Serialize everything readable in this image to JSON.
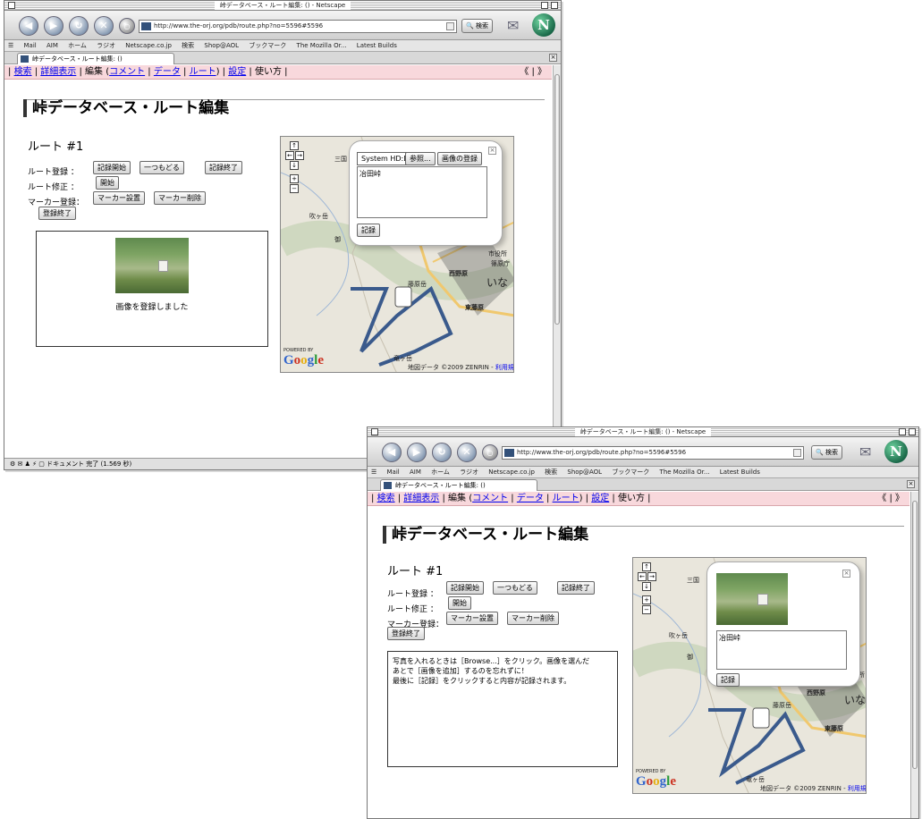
{
  "window": {
    "title": "峠データベース・ルート編集: () - Netscape",
    "url": "http://www.the-orj.org/pdb/route.php?no=5596#5596",
    "search_label": "検索",
    "tab_title_front": "峠データベース・ルート編集: ()",
    "tab_title_back": "峠データベース・ルート編集: ()",
    "personal_toolbar": [
      "Mail",
      "AIM",
      "ホーム",
      "ラジオ",
      "Netscape.co.jp",
      "検索",
      "Shop@AOL",
      "ブックマーク",
      "The Mozilla Or...",
      "Latest Builds"
    ],
    "status_text": "ドキュメント 完了 (1.569 秒)"
  },
  "nav": {
    "items": [
      {
        "label": "検索",
        "link": true
      },
      {
        "label": "詳細表示",
        "link": true
      },
      {
        "label": "編集",
        "link": false
      },
      {
        "label": "コメント",
        "link": true
      },
      {
        "label": "データ",
        "link": true
      },
      {
        "label": "ルート",
        "link": true
      },
      {
        "label": "設定",
        "link": true
      },
      {
        "label": "使い方",
        "link": false
      }
    ],
    "pager": "《 | 》"
  },
  "page": {
    "title": "峠データベース・ルート編集",
    "route_label": "ルート #1"
  },
  "form": {
    "route_register_label": "ルート登録 ：",
    "route_modify_label": "ルート修正 ：",
    "marker_register_label": "マーカー登録：",
    "btn_record_start": "記録開始",
    "btn_undo": "一つもどる",
    "btn_record_end": "記録終了",
    "btn_start": "開始",
    "btn_marker_set": "マーカー設置",
    "btn_marker_delete": "マーカー削除",
    "btn_register_end": "登録終了"
  },
  "status_box": {
    "message": "画像を登録しました"
  },
  "instructions": {
    "text": "写真を入れるときは［Browse...］をクリック。画像を選んだ\nあとで［画像を追加］するのを忘れずに！\n最後に［記録］をクリックすると内容が記録されます。"
  },
  "map": {
    "labels": [
      "三国",
      "吹ヶ岳",
      "市役所",
      "篠原庁",
      "西野原",
      "いな",
      "東藤原",
      "藤原岳",
      "竜ヶ岳",
      "御"
    ],
    "copyright": "地図データ ©2009 ZENRIN -",
    "terms_link": "利用規約",
    "powered_by": "POWERED BY",
    "google": [
      "G",
      "o",
      "o",
      "g",
      "l",
      "e"
    ]
  },
  "popup_front": {
    "file_value": "System HD:De",
    "browse_label": "参照...",
    "add_image_label": "画像の登録",
    "textarea_value": "冶田峠",
    "record_label": "記録"
  },
  "popup_back": {
    "textarea_value": "冶田峠",
    "record_label": "記録"
  },
  "colors": {
    "nav_bg": "#f8d8dc",
    "route_line": "#3a5a8c",
    "link": "#0000ee"
  }
}
